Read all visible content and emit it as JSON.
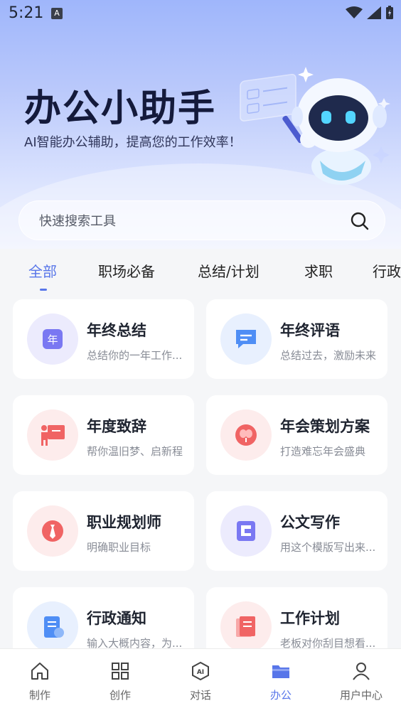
{
  "status_bar": {
    "time": "5:21",
    "notif": "A"
  },
  "hero": {
    "title": "办公小助手",
    "subtitle": "AI智能办公辅助，提高您的工作效率！"
  },
  "search": {
    "placeholder": "快速搜索工具"
  },
  "tabs": [
    {
      "label": "全部",
      "active": true
    },
    {
      "label": "职场必备"
    },
    {
      "label": "总结/计划"
    },
    {
      "label": "求职"
    },
    {
      "label": "行政"
    }
  ],
  "tools": [
    {
      "title": "年终总结",
      "desc": "总结你的一年工作...",
      "icon": "year-calendar-icon",
      "color": "#7a78f2",
      "bg": "#ecebfd"
    },
    {
      "title": "年终评语",
      "desc": "总结过去，激励未来",
      "icon": "chat-bubble-icon",
      "color": "#4f8ef5",
      "bg": "#e8f0fe"
    },
    {
      "title": "年度致辞",
      "desc": "帮你温旧梦、启新程",
      "icon": "presentation-icon",
      "color": "#f06464",
      "bg": "#fdecec"
    },
    {
      "title": "年会策划方案",
      "desc": "打造难忘年会盛典",
      "icon": "balloon-icon",
      "color": "#f06464",
      "bg": "#fdecec"
    },
    {
      "title": "职业规划师",
      "desc": "明确职业目标",
      "icon": "tie-icon",
      "color": "#f06464",
      "bg": "#fdecec"
    },
    {
      "title": "公文写作",
      "desc": "用这个模版写出来...",
      "icon": "document-flag-icon",
      "color": "#7a78f2",
      "bg": "#ecebfd"
    },
    {
      "title": "行政通知",
      "desc": "输入大概内容，为...",
      "icon": "notice-icon",
      "color": "#4f8ef5",
      "bg": "#e8f0fe"
    },
    {
      "title": "工作计划",
      "desc": "老板对你刮目想看...",
      "icon": "plan-book-icon",
      "color": "#f06464",
      "bg": "#fdecec"
    }
  ],
  "nav": [
    {
      "label": "制作",
      "icon": "home-icon"
    },
    {
      "label": "创作",
      "icon": "grid-icon"
    },
    {
      "label": "对话",
      "icon": "ai-chat-icon"
    },
    {
      "label": "办公",
      "icon": "folder-icon",
      "active": true
    },
    {
      "label": "用户中心",
      "icon": "user-icon"
    }
  ],
  "colors": {
    "accent": "#5876e9",
    "text": "#1f2430",
    "muted": "#888c96"
  }
}
